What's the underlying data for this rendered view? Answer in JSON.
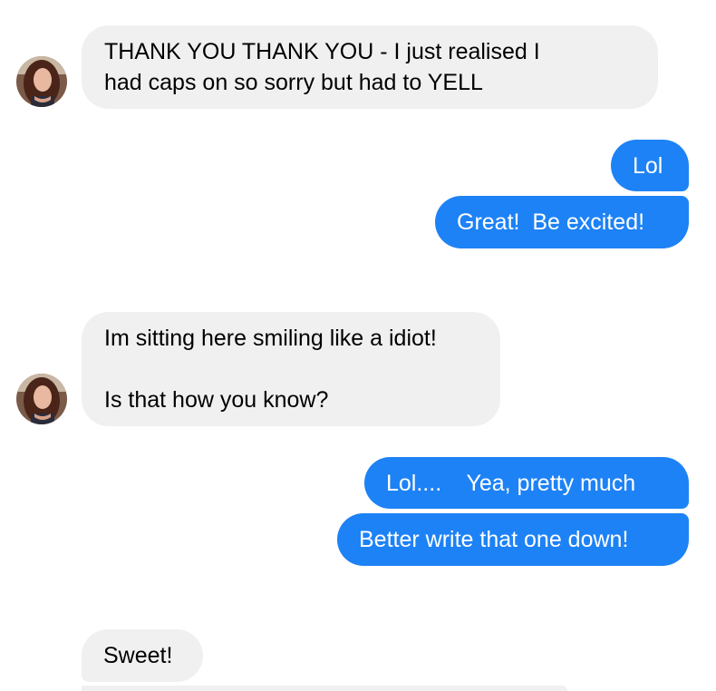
{
  "conversation": {
    "messages": [
      {
        "sender": "contact",
        "text": "THANK YOU THANK YOU - I just realised I\nhad caps on so sorry but had to YELL"
      },
      {
        "sender": "me",
        "text": "Lol"
      },
      {
        "sender": "me",
        "text": "Great!  Be excited!"
      },
      {
        "sender": "contact",
        "text": "Im sitting here smiling like a idiot!\n\nIs that how you know?"
      },
      {
        "sender": "me",
        "text": "Lol....    Yea, pretty much"
      },
      {
        "sender": "me",
        "text": "Better write that one down!"
      },
      {
        "sender": "contact",
        "text": "Sweet!"
      }
    ]
  },
  "colors": {
    "incoming_bubble": "#f0f0f0",
    "outgoing_bubble": "#1d82f5",
    "outgoing_text": "#ffffff"
  }
}
